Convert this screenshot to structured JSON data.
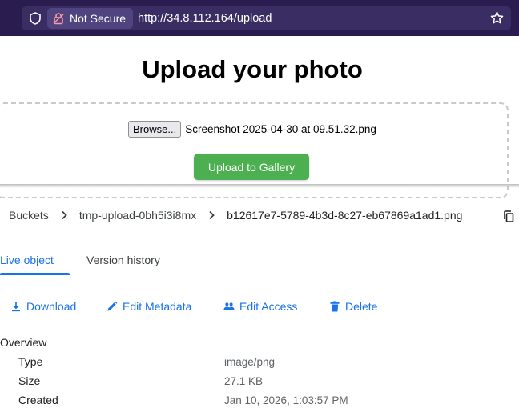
{
  "browser": {
    "security_label": "Not Secure",
    "url": "http://34.8.112.164/upload"
  },
  "upload_page": {
    "title": "Upload your photo",
    "browse_label": "Browse...",
    "file_name": "Screenshot 2025-04-30 at 09.51.32.png",
    "submit_label": "Upload to Gallery",
    "accent_color": "#4caf50"
  },
  "console": {
    "breadcrumb": [
      "Buckets",
      "tmp-upload-0bh5i3i8mx",
      "b12617e7-5789-4b3d-8c27-eb67869a1ad1.png"
    ],
    "tabs": [
      "Live object",
      "Version history"
    ],
    "actions": {
      "download": "Download",
      "edit_metadata": "Edit Metadata",
      "edit_access": "Edit Access",
      "delete": "Delete"
    },
    "overview": {
      "heading": "Overview",
      "rows": [
        {
          "label": "Type",
          "value": "image/png"
        },
        {
          "label": "Size",
          "value": "27.1 KB"
        },
        {
          "label": "Created",
          "value": "Jan 10, 2026, 1:03:57 PM"
        }
      ]
    },
    "link_color": "#1a73e8"
  }
}
